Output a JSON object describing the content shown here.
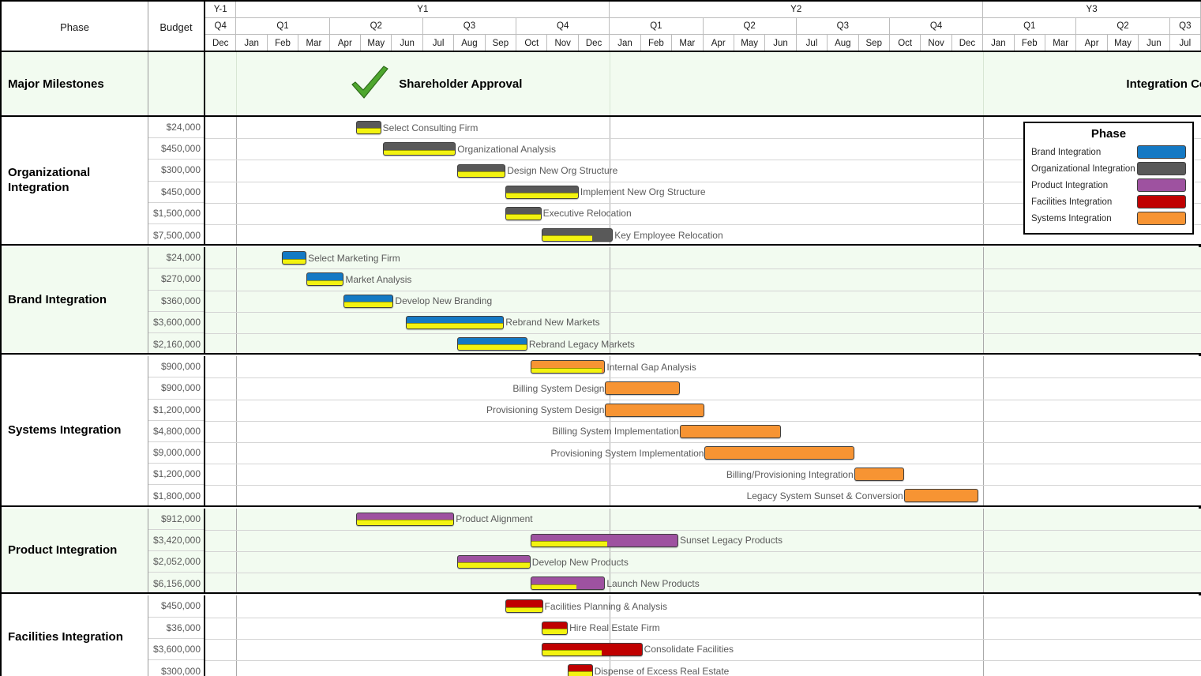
{
  "header": {
    "phase_label": "Phase",
    "budget_label": "Budget",
    "years": [
      {
        "label": "Y-1",
        "span": 1
      },
      {
        "label": "Y1",
        "span": 12
      },
      {
        "label": "Y2",
        "span": 12
      },
      {
        "label": "Y3",
        "span": 7
      }
    ],
    "quarters": [
      {
        "label": "Q4",
        "span": 1
      },
      {
        "label": "Q1",
        "span": 3
      },
      {
        "label": "Q2",
        "span": 3
      },
      {
        "label": "Q3",
        "span": 3
      },
      {
        "label": "Q4",
        "span": 3
      },
      {
        "label": "Q1",
        "span": 3
      },
      {
        "label": "Q2",
        "span": 3
      },
      {
        "label": "Q3",
        "span": 3
      },
      {
        "label": "Q4",
        "span": 3
      },
      {
        "label": "Q1",
        "span": 3
      },
      {
        "label": "Q2",
        "span": 3
      },
      {
        "label": "Q3",
        "span": 1
      }
    ],
    "months": [
      "Dec",
      "Jan",
      "Feb",
      "Mar",
      "Apr",
      "May",
      "Jun",
      "Jul",
      "Aug",
      "Sep",
      "Oct",
      "Nov",
      "Dec",
      "Jan",
      "Feb",
      "Mar",
      "Apr",
      "May",
      "Jun",
      "Jul",
      "Aug",
      "Sep",
      "Oct",
      "Nov",
      "Dec",
      "Jan",
      "Feb",
      "Mar",
      "Apr",
      "May",
      "Jun",
      "Jul"
    ]
  },
  "milestones_row": {
    "label": "Major Milestones",
    "items": [
      {
        "name": "Shareholder Approval",
        "icon": "green-check-icon",
        "start_month": 4.6,
        "icon_side": "left"
      },
      {
        "name": "Integration Complete",
        "icon": "green-flag-icon",
        "start_month": 29.6,
        "icon_side": "right"
      }
    ]
  },
  "legend": {
    "title": "Phase",
    "entries": [
      {
        "label": "Brand Integration",
        "color": "#1479c4"
      },
      {
        "label": "Organizational Integration",
        "color": "#595959"
      },
      {
        "label": "Product Integration",
        "color": "#9e52a0"
      },
      {
        "label": "Facilities Integration",
        "color": "#c00000"
      },
      {
        "label": "Systems Integration",
        "color": "#f79433"
      }
    ]
  },
  "colors": {
    "brand": "#1479c4",
    "organizational": "#595959",
    "product": "#9e52a0",
    "facilities": "#c00000",
    "systems": "#f79433",
    "progress": "#f3f310",
    "milestone_green": "#4ea72e",
    "group_tint": "#f2fbf0",
    "group_white": "#ffffff"
  },
  "groups": [
    {
      "name": "Organizational Integration",
      "color": "#595959",
      "tint": "#ffffff",
      "tasks": [
        {
          "name": "Select Consulting Firm",
          "budget": "$24,000",
          "start": 4.85,
          "end": 5.65,
          "progress": 100,
          "label_side": "right"
        },
        {
          "name": "Organizational Analysis",
          "budget": "$450,000",
          "start": 5.7,
          "end": 8.05,
          "progress": 100,
          "label_side": "right"
        },
        {
          "name": "Design New Org Structure",
          "budget": "$300,000",
          "start": 8.1,
          "end": 9.65,
          "progress": 100,
          "label_side": "right"
        },
        {
          "name": "Implement New Org Structure",
          "budget": "$450,000",
          "start": 9.65,
          "end": 12.0,
          "progress": 100,
          "label_side": "right"
        },
        {
          "name": "Executive Relocation",
          "budget": "$1,500,000",
          "start": 9.65,
          "end": 10.8,
          "progress": 100,
          "label_side": "right"
        },
        {
          "name": "Key Employee Relocation",
          "budget": "$7,500,000",
          "start": 10.8,
          "end": 13.1,
          "progress": 72,
          "label_side": "right"
        }
      ]
    },
    {
      "name": "Brand Integration",
      "color": "#1479c4",
      "tint": "#f2fbf0",
      "tasks": [
        {
          "name": "Select Marketing Firm",
          "budget": "$24,000",
          "start": 2.45,
          "end": 3.25,
          "progress": 100,
          "label_side": "right"
        },
        {
          "name": "Market Analysis",
          "budget": "$270,000",
          "start": 3.25,
          "end": 4.45,
          "progress": 100,
          "label_side": "right"
        },
        {
          "name": "Develop New Branding",
          "budget": "$360,000",
          "start": 4.45,
          "end": 6.05,
          "progress": 100,
          "label_side": "right"
        },
        {
          "name": "Rebrand New Markets",
          "budget": "$3,600,000",
          "start": 6.45,
          "end": 9.6,
          "progress": 100,
          "label_side": "right"
        },
        {
          "name": "Rebrand Legacy Markets",
          "budget": "$2,160,000",
          "start": 8.1,
          "end": 10.35,
          "progress": 100,
          "label_side": "right"
        }
      ]
    },
    {
      "name": "Systems Integration",
      "color": "#f79433",
      "tint": "#ffffff",
      "tasks": [
        {
          "name": "Internal Gap Analysis",
          "budget": "$900,000",
          "start": 10.45,
          "end": 12.85,
          "progress": 96,
          "label_side": "right"
        },
        {
          "name": "Billing System Design",
          "budget": "$900,000",
          "start": 12.85,
          "end": 15.25,
          "progress": 0,
          "label_side": "left"
        },
        {
          "name": "Provisioning System Design",
          "budget": "$1,200,000",
          "start": 12.85,
          "end": 16.05,
          "progress": 0,
          "label_side": "left"
        },
        {
          "name": "Billing System Implementation",
          "budget": "$4,800,000",
          "start": 15.25,
          "end": 18.5,
          "progress": 0,
          "label_side": "left"
        },
        {
          "name": "Provisioning System Implementation",
          "budget": "$9,000,000",
          "start": 16.05,
          "end": 20.85,
          "progress": 0,
          "label_side": "left"
        },
        {
          "name": "Billing/Provisioning Integration",
          "budget": "$1,200,000",
          "start": 20.85,
          "end": 22.45,
          "progress": 0,
          "label_side": "left"
        },
        {
          "name": "Legacy System Sunset & Conversion",
          "budget": "$1,800,000",
          "start": 22.45,
          "end": 24.85,
          "progress": 0,
          "label_side": "left"
        }
      ]
    },
    {
      "name": "Product Integration",
      "color": "#9e52a0",
      "tint": "#f2fbf0",
      "tasks": [
        {
          "name": "Product Alignment",
          "budget": "$912,000",
          "start": 4.85,
          "end": 8.0,
          "progress": 100,
          "label_side": "right"
        },
        {
          "name": "Sunset Legacy Products",
          "budget": "$3,420,000",
          "start": 10.45,
          "end": 15.2,
          "progress": 52,
          "label_side": "right"
        },
        {
          "name": "Develop New Products",
          "budget": "$2,052,000",
          "start": 8.1,
          "end": 10.45,
          "progress": 100,
          "label_side": "right"
        },
        {
          "name": "Launch New Products",
          "budget": "$6,156,000",
          "start": 10.45,
          "end": 12.85,
          "progress": 62,
          "label_side": "right"
        }
      ]
    },
    {
      "name": "Facilities Integration",
      "color": "#c00000",
      "tint": "#ffffff",
      "tasks": [
        {
          "name": "Facilities Planning & Analysis",
          "budget": "$450,000",
          "start": 9.65,
          "end": 10.85,
          "progress": 100,
          "label_side": "right"
        },
        {
          "name": "Hire Real Estate Firm",
          "budget": "$36,000",
          "start": 10.8,
          "end": 11.65,
          "progress": 100,
          "label_side": "right"
        },
        {
          "name": "Consolidate Facilities",
          "budget": "$3,600,000",
          "start": 10.8,
          "end": 14.05,
          "progress": 60,
          "label_side": "right"
        },
        {
          "name": "Dispense of Excess Real Estate",
          "budget": "$300,000",
          "start": 11.65,
          "end": 12.45,
          "progress": 100,
          "label_side": "right"
        }
      ]
    }
  ]
}
